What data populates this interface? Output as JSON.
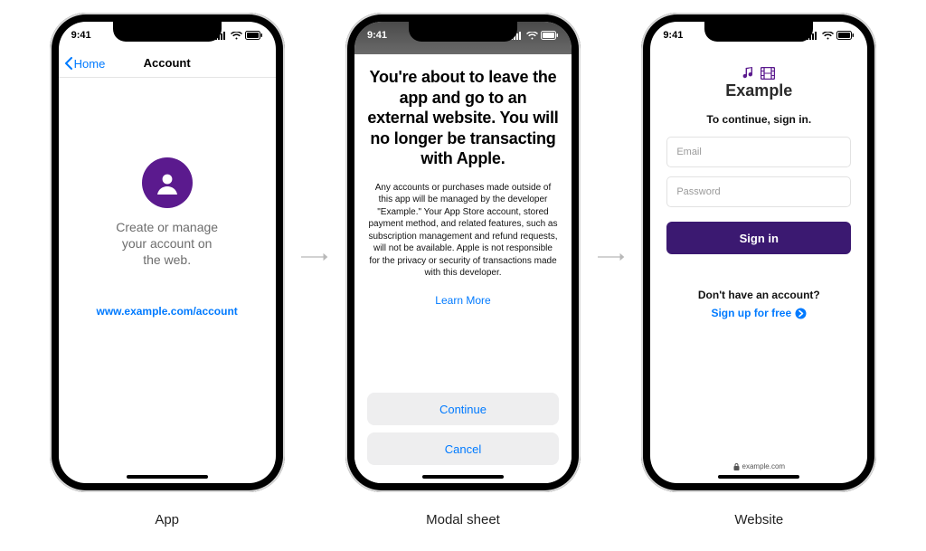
{
  "status": {
    "time": "9:41"
  },
  "captions": {
    "app": "App",
    "modal": "Modal sheet",
    "website": "Website"
  },
  "screen_app": {
    "back_label": "Home",
    "title": "Account",
    "body_line1": "Create or manage",
    "body_line2": "your account on",
    "body_line3": "the web.",
    "link": "www.example.com/account"
  },
  "screen_modal": {
    "title": "You're about to leave the app and go to an external website. You will no longer be transacting with Apple.",
    "paragraph": "Any accounts or purchases made outside of this app will be managed by the developer \"Example.\" Your App Store account, stored payment method, and related features, such as subscription management and refund requests, will not be available. Apple is not responsible for the privacy or security of transactions made with this developer.",
    "learn_more": "Learn More",
    "continue": "Continue",
    "cancel": "Cancel"
  },
  "screen_website": {
    "brand": "Example",
    "subtitle": "To continue, sign in.",
    "email_placeholder": "Email",
    "password_placeholder": "Password",
    "signin": "Sign in",
    "no_account": "Don't have an account?",
    "signup": "Sign up for free",
    "domain": "example.com"
  }
}
